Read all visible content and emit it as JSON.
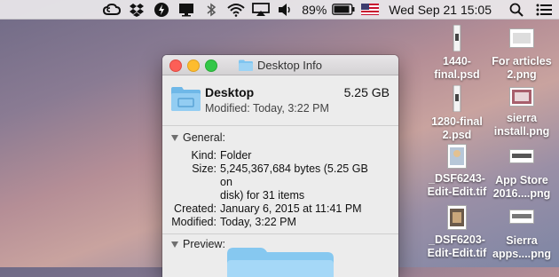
{
  "menubar": {
    "battery": "89%",
    "datetime": "Wed Sep 21  15:05"
  },
  "desktop_icons": [
    {
      "label_line1": "1440-",
      "label_line2": "final.psd"
    },
    {
      "label_line1": "For articles",
      "label_line2": "2.png"
    },
    {
      "label_line1": "1280-final",
      "label_line2": "2.psd"
    },
    {
      "label_line1": "sierra",
      "label_line2": "install.png"
    },
    {
      "label_line1": "_DSF6243-",
      "label_line2": "Edit-Edit.tif"
    },
    {
      "label_line1": "App Store",
      "label_line2": "2016....png"
    },
    {
      "label_line1": "_DSF6203-",
      "label_line2": "Edit-Edit.tif"
    },
    {
      "label_line1": "Sierra",
      "label_line2": "apps....png"
    }
  ],
  "window": {
    "title": "Desktop Info",
    "name": "Desktop",
    "size": "5.25 GB",
    "modified_summary": "Modified: Today, 3:22 PM",
    "general": {
      "label": "General:",
      "kind_key": "Kind:",
      "kind": "Folder",
      "size_key": "Size:",
      "size_line1": "5,245,367,684 bytes (5.25 GB on",
      "size_line2": "disk) for 31 items",
      "created_key": "Created:",
      "created": "January 6, 2015 at 11:41 PM",
      "modified_key": "Modified:",
      "modified": "Today, 3:22 PM"
    },
    "preview": {
      "label": "Preview:"
    }
  },
  "colors": {
    "close": "#fc5f57",
    "minimize": "#fdbc2e",
    "zoom": "#33c748",
    "folder": "#7fc5f0"
  },
  "icons": [
    "creative-cloud-icon",
    "dropbox-icon",
    "bolt-icon",
    "display-icon",
    "bluetooth-icon",
    "wifi-icon",
    "airplay-icon",
    "volume-icon",
    "battery-icon",
    "us-flag-icon",
    "search-icon",
    "list-icon",
    "folder-icon",
    "disclosure-triangle-icon"
  ]
}
